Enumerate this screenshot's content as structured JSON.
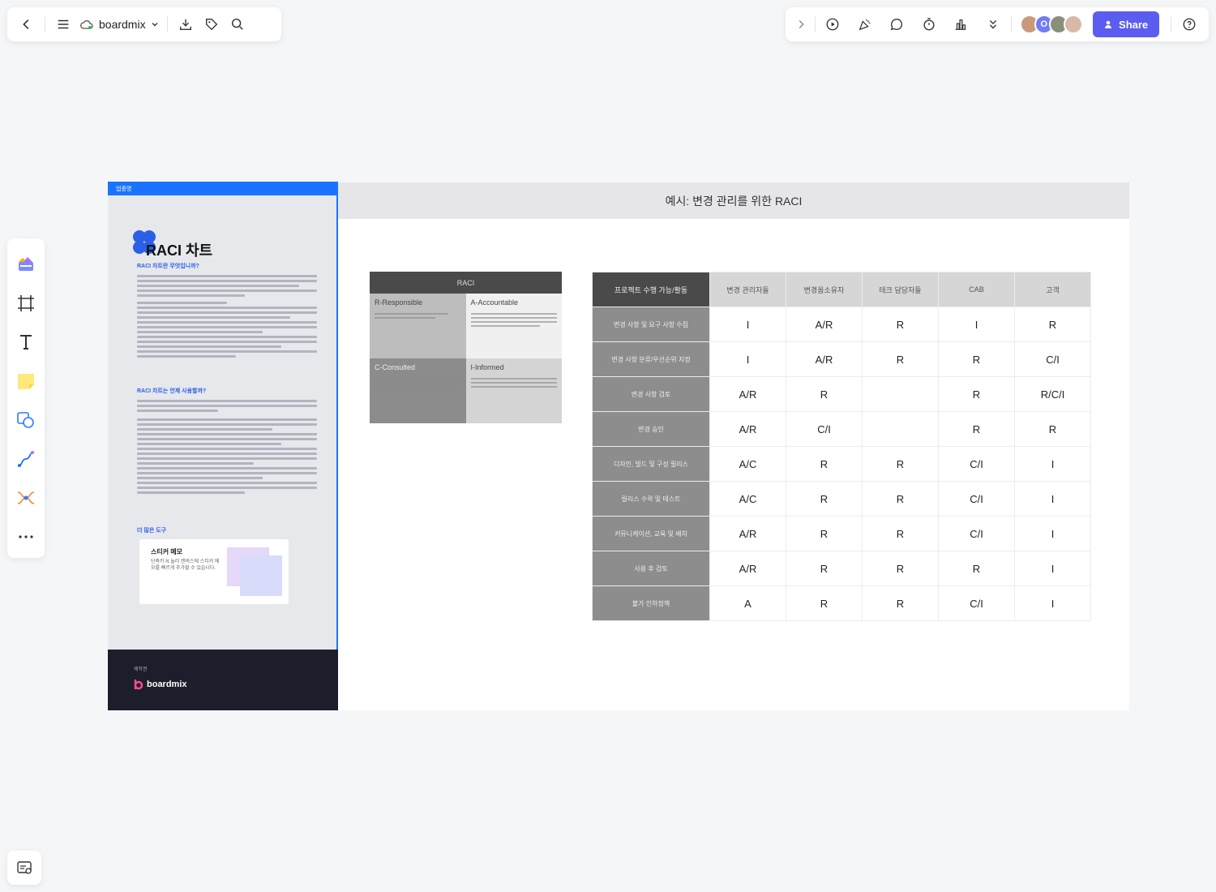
{
  "toolbar_left": {
    "brand_name": "boardmix"
  },
  "toolbar_right": {
    "share_label": "Share",
    "avatar_badge": "O"
  },
  "document_card": {
    "tag": "업종명",
    "title": "RACI 차트",
    "section1_heading": "RACI 차트란 무엇입니까?",
    "section2_heading": "RACI 차트는 언제 사용할까?",
    "section3_heading": "더 많은 도구",
    "sticky_title": "스티커 메모",
    "sticky_desc": "단축키 N 눌러 캔버스에 스티커 메모를 빠르게 추가할 수 있습니다.",
    "footer_label": "제작권",
    "footer_brand": "boardmix"
  },
  "board": {
    "title": "예시: 변경 관리를 위한 RACI",
    "raci_box": {
      "header": "RACI",
      "cells": [
        "R-Responsible",
        "A-Accountable",
        "C-Consulted",
        "I-Informed"
      ]
    },
    "matrix": {
      "corner": "프로젝트 수행 가능/활동",
      "columns": [
        "변경 관리자들",
        "변경옵소유자",
        "테크 담당자들",
        "CAB",
        "고객"
      ],
      "rows": [
        {
          "label": "변경 사항 및 요구 사항 수집",
          "cells": [
            "I",
            "A/R",
            "R",
            "I",
            "R"
          ]
        },
        {
          "label": "변경 사항 분류/우선순위 지정",
          "cells": [
            "I",
            "A/R",
            "R",
            "R",
            "C/I"
          ]
        },
        {
          "label": "변경 사항 검토",
          "cells": [
            "A/R",
            "R",
            "",
            "R",
            "R/C/I"
          ]
        },
        {
          "label": "변경 승인",
          "cells": [
            "A/R",
            "C/I",
            "",
            "R",
            "R"
          ]
        },
        {
          "label": "디자인, 빌드 및 구성 릴리스",
          "cells": [
            "A/C",
            "R",
            "R",
            "C/I",
            "I"
          ]
        },
        {
          "label": "릴리스 수락 및 테스트",
          "cells": [
            "A/C",
            "R",
            "R",
            "C/I",
            "I"
          ]
        },
        {
          "label": "커뮤니케이션, 교육 및 배치",
          "cells": [
            "A/R",
            "R",
            "R",
            "C/I",
            "I"
          ]
        },
        {
          "label": "사용 후 검토",
          "cells": [
            "A/R",
            "R",
            "R",
            "R",
            "I"
          ]
        },
        {
          "label": "불가 인하정책",
          "cells": [
            "A",
            "R",
            "R",
            "C/I",
            "I"
          ]
        }
      ]
    }
  },
  "colors": {
    "accent": "#5b5cf0",
    "doc_blue": "#1a73ff",
    "footer_dark": "#1d1e2b"
  }
}
